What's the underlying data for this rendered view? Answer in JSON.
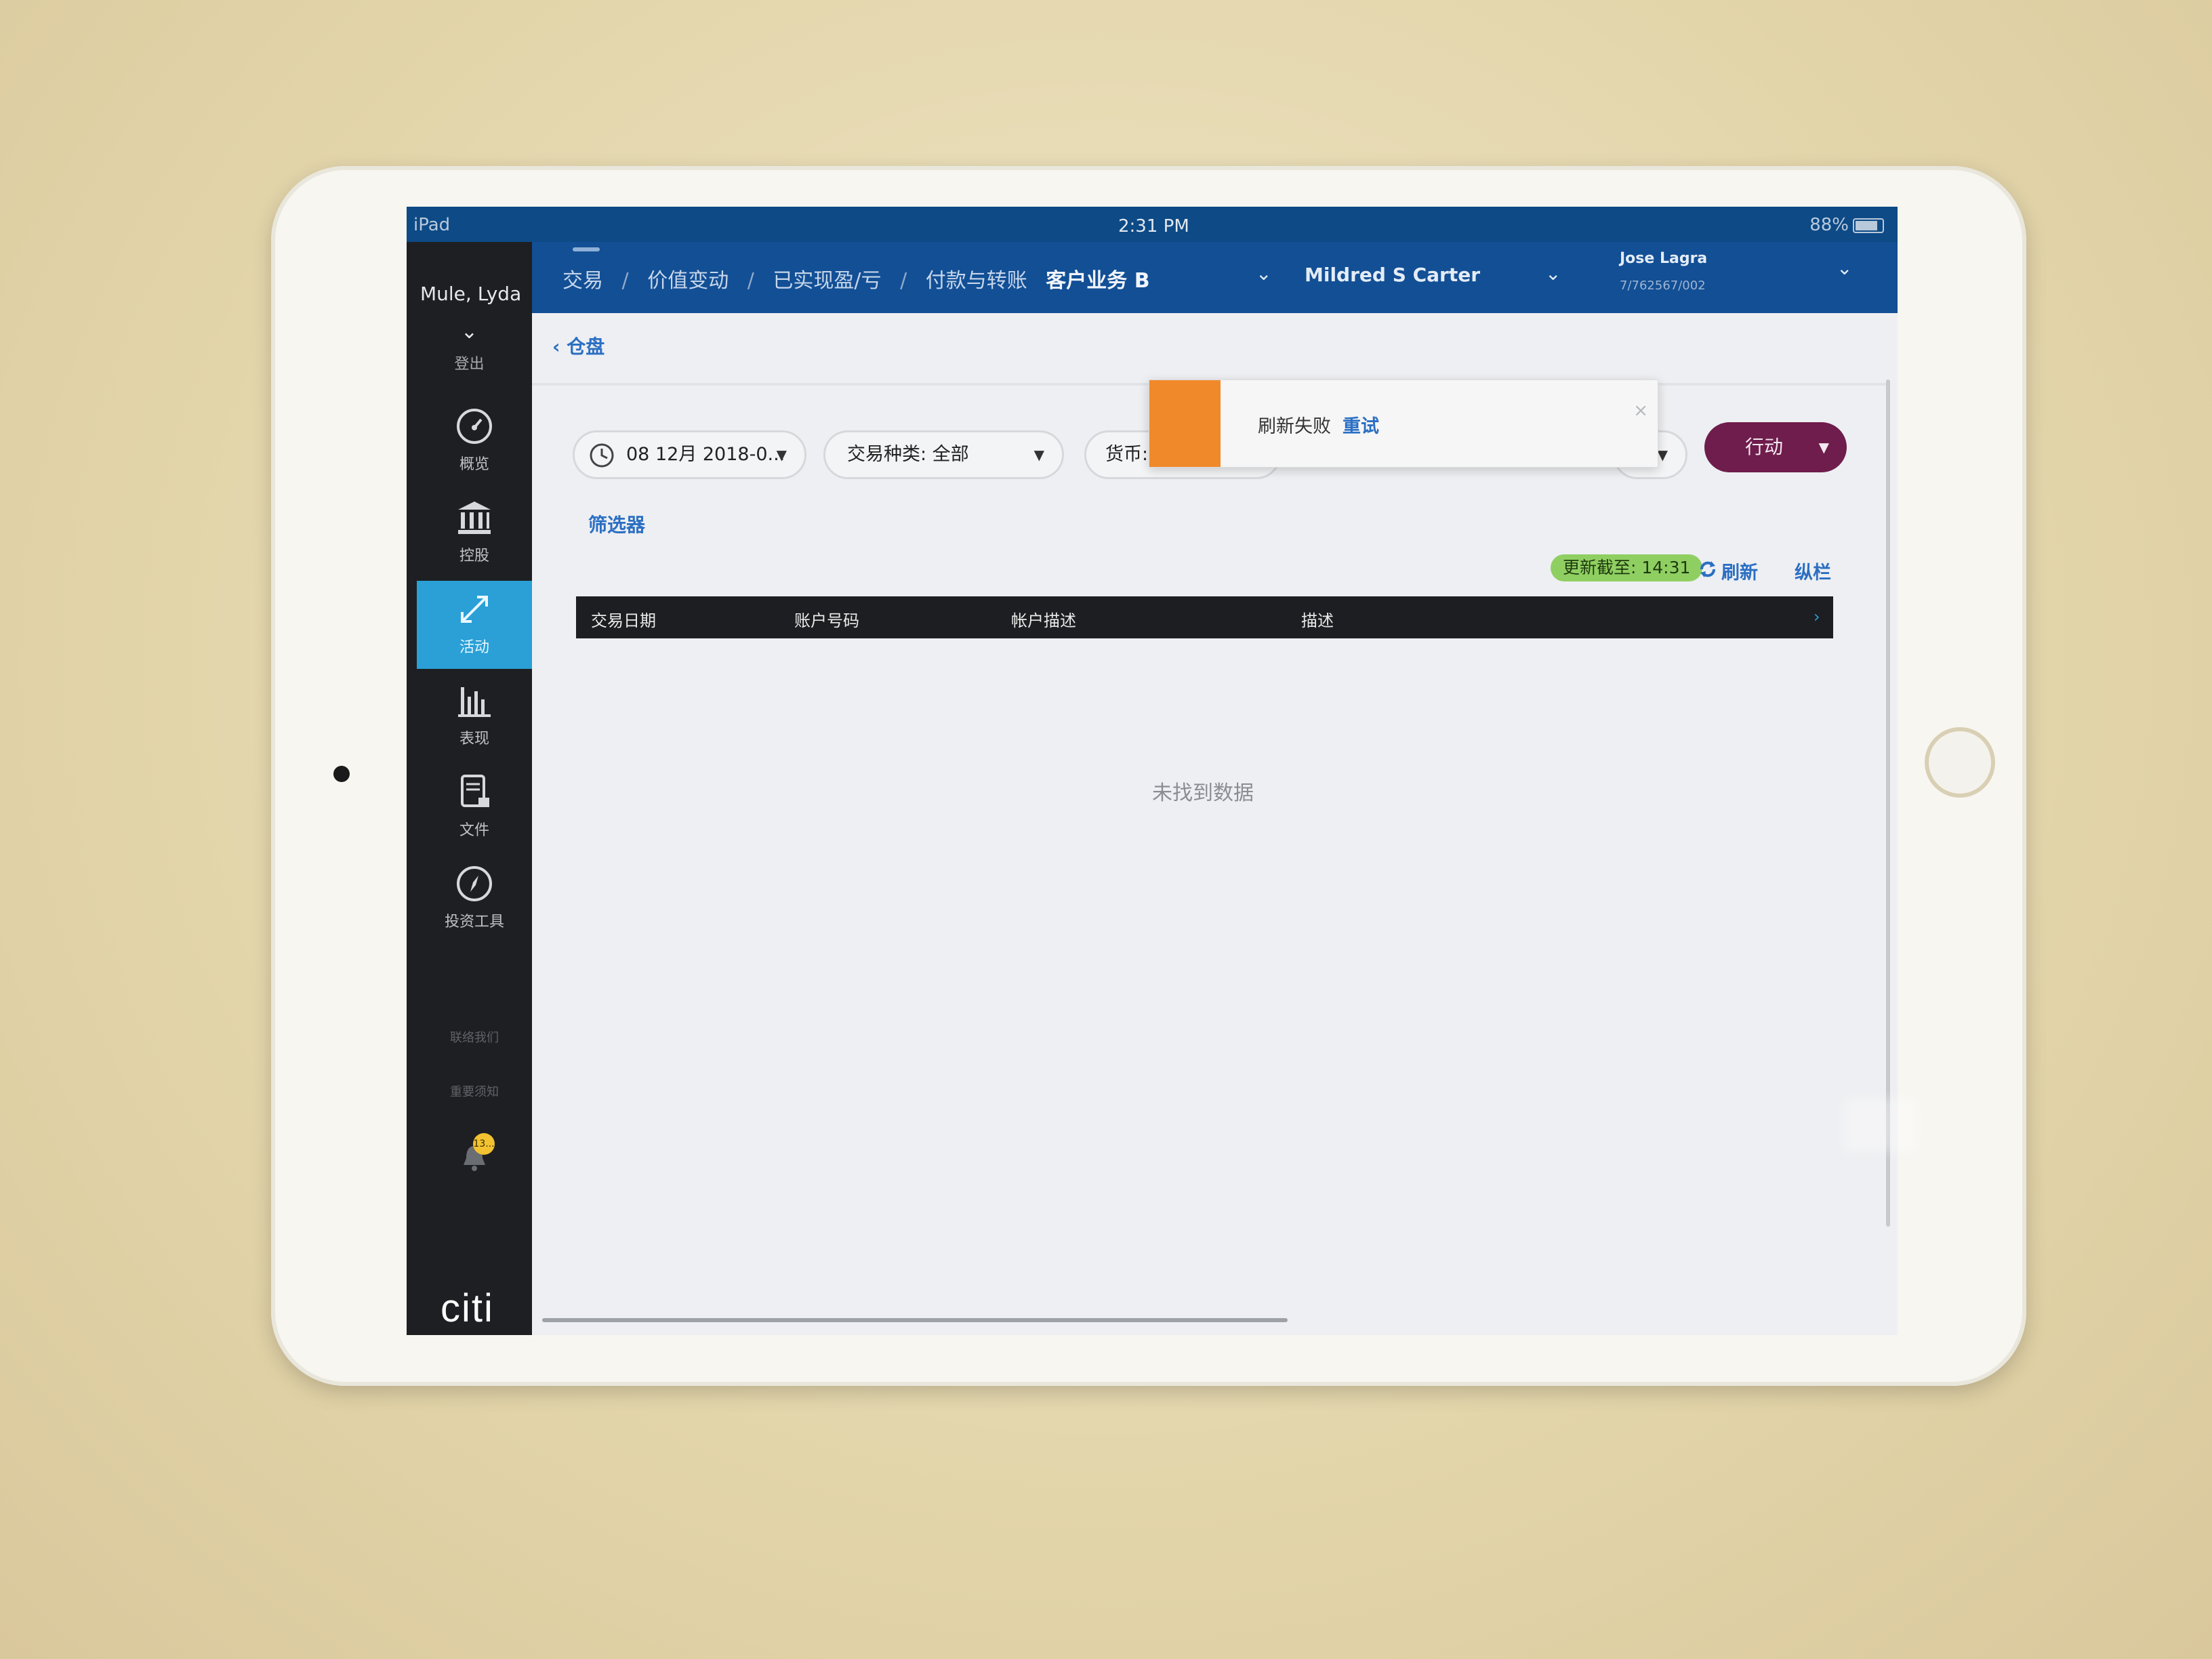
{
  "device": {
    "name": "iPad"
  },
  "status_bar": {
    "left": "iPad",
    "time": "2:31 PM",
    "battery": "88%"
  },
  "sidebar": {
    "user": "Mule, Lyda",
    "logout": "登出",
    "items": [
      {
        "label": "概览",
        "icon": "speedometer-icon"
      },
      {
        "label": "控股",
        "icon": "bank-icon"
      },
      {
        "label": "活动",
        "icon": "arrows-diagonal-icon"
      },
      {
        "label": "表现",
        "icon": "bar-chart-icon"
      },
      {
        "label": "文件",
        "icon": "document-lock-icon"
      },
      {
        "label": "投资工具",
        "icon": "compass-icon"
      }
    ],
    "contact": "联络我们",
    "notice": "重要须知",
    "notification_count": "13...",
    "brand": "citi"
  },
  "topnav": {
    "tabs": [
      "交易",
      "价值变动",
      "已实现盈/亏",
      "付款与转账"
    ],
    "separator": "/",
    "portfolio": "客户业务 B",
    "account_name": "Mildred S Carter",
    "client_name": "Jose Lagra",
    "client_id": "7/762567/002"
  },
  "page": {
    "back_label": "仓盘",
    "filters": {
      "date": "08 12月 2018-0...",
      "type": "交易种类: 全部",
      "currency": "货币:"
    },
    "action_label": "行动",
    "filter_link": "筛选器",
    "updated": "更新截至: 14:31",
    "refresh": "刷新",
    "columns": "纵栏",
    "table_headers": [
      "交易日期",
      "账户号码",
      "帐户描述",
      "描述"
    ],
    "empty_message": "未找到数据"
  },
  "toast": {
    "message": "刷新失败",
    "retry": "重试",
    "close": "×"
  },
  "colors": {
    "accent": "#2aa0d6",
    "nav": "#124f95",
    "action": "#6e1d4c",
    "warning": "#f0892a",
    "updated": "#8fcf62"
  }
}
